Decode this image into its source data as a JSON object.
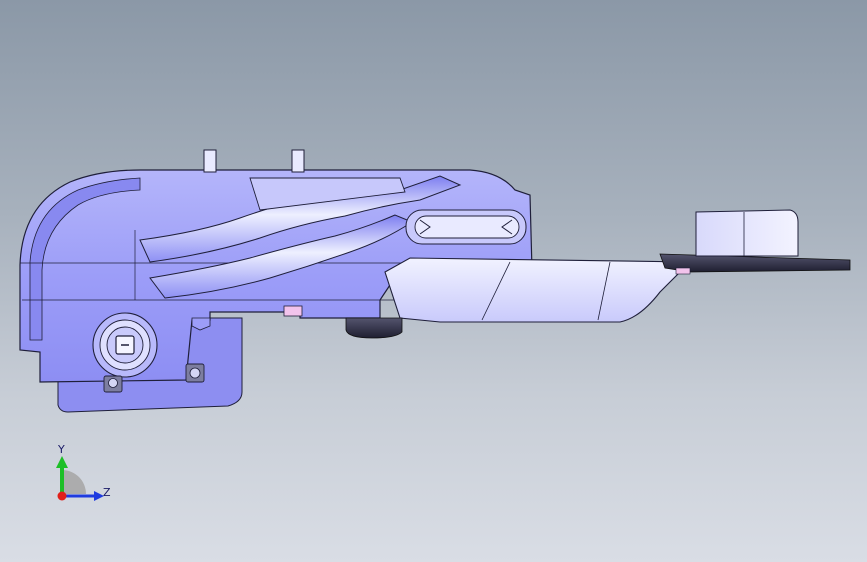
{
  "viewport": {
    "background_top": "#8b98a7",
    "background_bottom": "#d9dde5"
  },
  "part": {
    "face_color": "#9c9df8",
    "face_light": "#c5c6fb",
    "face_pale": "#e7e8fd",
    "edge_color": "#1f1f3a",
    "dark_color": "#3b3b55",
    "pink_marker": "#f2c3ec"
  },
  "triad": {
    "y_label": "Y",
    "z_label": "Z",
    "x_color": "#e0201a",
    "y_color": "#1dbf27",
    "z_color": "#1f3be0",
    "icons": [
      "coordinate-triad-icon"
    ]
  }
}
